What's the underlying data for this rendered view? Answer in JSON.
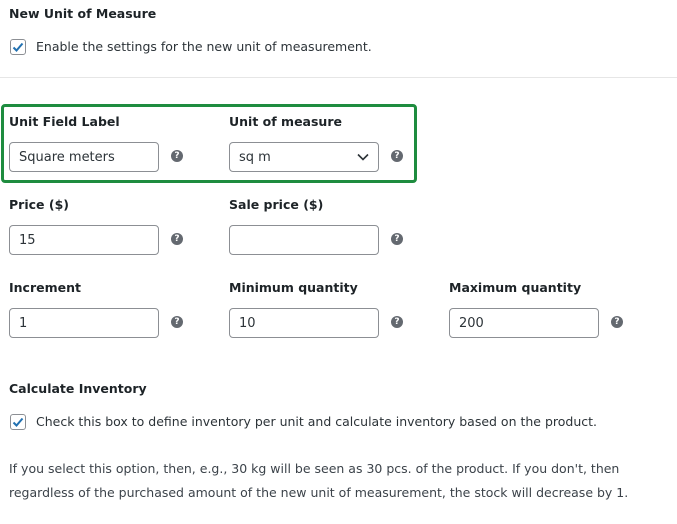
{
  "new_unit": {
    "title": "New Unit of Measure",
    "enable_checkbox": {
      "checked": true,
      "label": "Enable the settings for the new unit of measurement."
    }
  },
  "fields": {
    "unit_field_label": {
      "label": "Unit Field Label",
      "value": "Square meters"
    },
    "unit_of_measure": {
      "label": "Unit of measure",
      "value": "sq m"
    },
    "price": {
      "label": "Price ($)",
      "value": "15"
    },
    "sale_price": {
      "label": "Sale price ($)",
      "value": ""
    },
    "increment": {
      "label": "Increment",
      "value": "1"
    },
    "minimum_quantity": {
      "label": "Minimum quantity",
      "value": "10"
    },
    "maximum_quantity": {
      "label": "Maximum quantity",
      "value": "200"
    }
  },
  "inventory": {
    "title": "Calculate Inventory",
    "checkbox": {
      "checked": true,
      "label": "Check this box to define inventory per unit and calculate inventory based on the product."
    },
    "description": "If you select this option, then, e.g., 30 kg will be seen as 30 pcs. of the product. If you don't, then regardless of the purchased amount of the new unit of measurement, the stock will decrease by 1."
  },
  "help_icon_glyph": "?",
  "colors": {
    "highlight_border": "#1e8c3f",
    "checkbox_check": "#2271b1"
  }
}
